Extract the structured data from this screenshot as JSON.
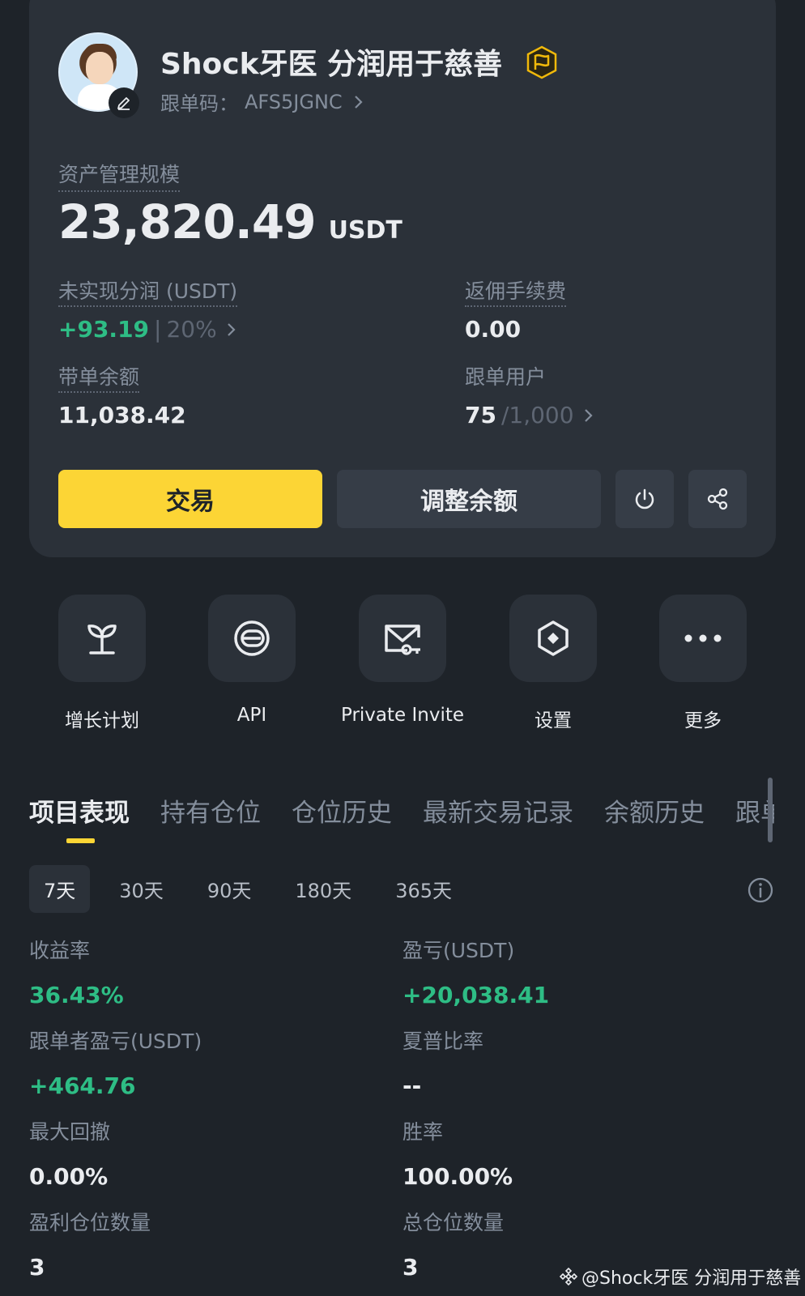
{
  "profile": {
    "name": "Shock牙医 分润用于慈善",
    "code_label": "跟单码：",
    "code_value": "AFS5JGNC"
  },
  "aum": {
    "label": "资产管理规模",
    "value": "23,820.49",
    "unit": "USDT"
  },
  "stats": {
    "unrealized_label": "未实现分润 (USDT)",
    "unrealized_value": "+93.19",
    "unrealized_sep": "|",
    "unrealized_percent": "20%",
    "rebate_label": "返佣手续费",
    "rebate_value": "0.00",
    "balance_label": "带单余额",
    "balance_value": "11,038.42",
    "followers_label": "跟单用户",
    "followers_value": "75",
    "followers_max": "/1,000"
  },
  "buttons": {
    "trade": "交易",
    "adjust": "调整余额"
  },
  "quick_actions": [
    {
      "label": "增长计划",
      "icon": "sprout-icon"
    },
    {
      "label": "API",
      "icon": "api-icon"
    },
    {
      "label": "Private Invite",
      "icon": "private-invite-icon"
    },
    {
      "label": "设置",
      "icon": "settings-icon"
    },
    {
      "label": "更多",
      "icon": "more-icon"
    }
  ],
  "tabs": [
    "项目表现",
    "持有仓位",
    "仓位历史",
    "最新交易记录",
    "余额历史",
    "跟单"
  ],
  "periods": [
    "7天",
    "30天",
    "90天",
    "180天",
    "365天"
  ],
  "metrics": {
    "roi_label": "收益率",
    "roi_value": "36.43%",
    "pnl_label": "盈亏(USDT)",
    "pnl_value": "+20,038.41",
    "copier_pnl_label": "跟单者盈亏(USDT)",
    "copier_pnl_value": "+464.76",
    "sharpe_label": "夏普比率",
    "sharpe_value": "--",
    "mdd_label": "最大回撤",
    "mdd_value": "0.00%",
    "winrate_label": "胜率",
    "winrate_value": "100.00%",
    "win_positions_label": "盈利仓位数量",
    "win_positions_value": "3",
    "total_positions_label": "总仓位数量",
    "total_positions_value": "3"
  },
  "watermark": "@Shock牙医 分润用于慈善",
  "colors": {
    "background": "#1e2329",
    "card": "#2b3139",
    "accent": "#fcd535",
    "positive": "#2ebd85",
    "muted": "#848e9c"
  }
}
